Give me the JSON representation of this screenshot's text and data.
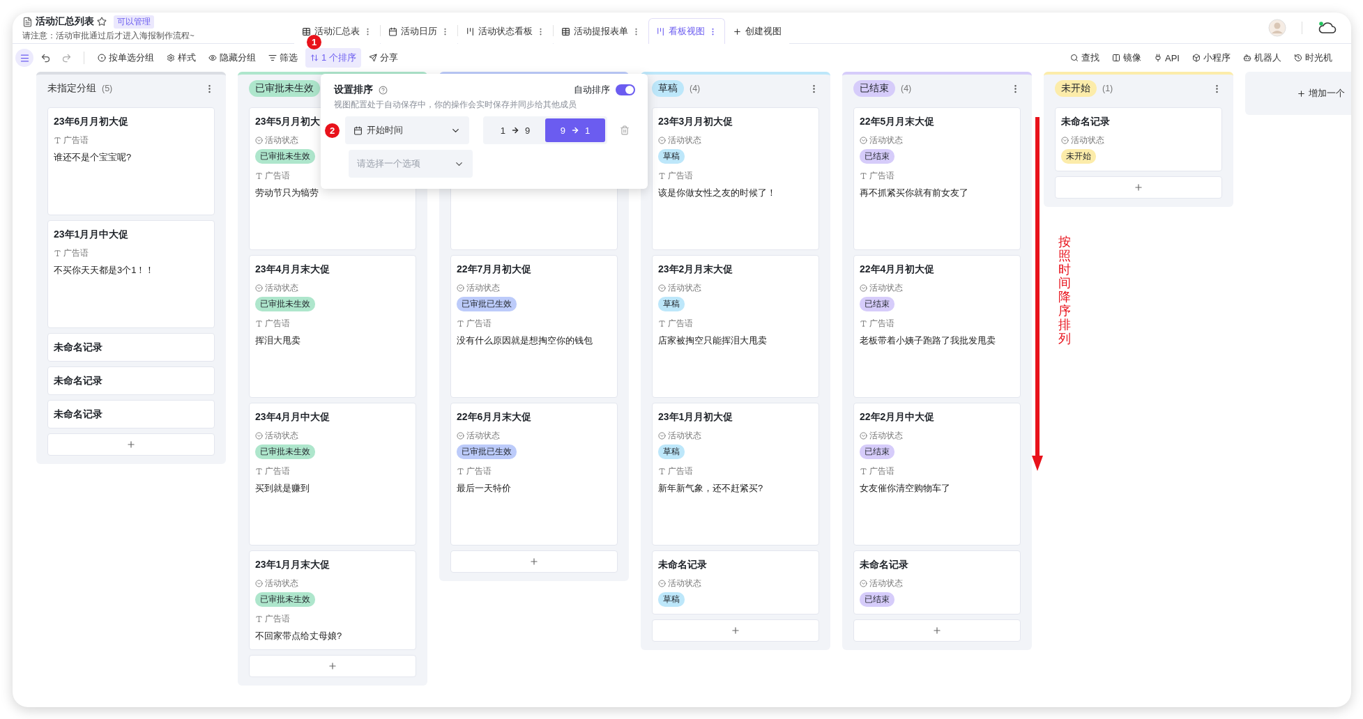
{
  "header": {
    "title": "活动汇总列表",
    "permission": "可以管理",
    "notice": "请注意：活动审批通过后才进入海报制作流程~"
  },
  "tabs": [
    {
      "label": "活动汇总表",
      "selected": false
    },
    {
      "label": "活动日历",
      "selected": false
    },
    {
      "label": "活动状态看板",
      "selected": false
    },
    {
      "label": "活动提报表单",
      "selected": false
    },
    {
      "label": "看板视图",
      "selected": true
    }
  ],
  "create_view": "创建视图",
  "toolbar": {
    "left": [
      {
        "label": "按单选分组",
        "selected": false
      },
      {
        "label": "样式",
        "selected": false
      },
      {
        "label": "隐藏分组",
        "selected": false
      },
      {
        "label": "筛选",
        "selected": false
      },
      {
        "label": "1 个排序",
        "selected": true
      },
      {
        "label": "分享",
        "selected": false
      }
    ],
    "right": [
      "查找",
      "镜像",
      "API",
      "小程序",
      "机器人",
      "时光机"
    ]
  },
  "annotations": {
    "step_1": "1",
    "step_2": "2",
    "note": "按照时间降序排列"
  },
  "sort_popup": {
    "title": "设置排序",
    "auto_sort_label": "自动排序",
    "auto_sort_on": true,
    "description": "视图配置处于自动保存中，你的操作会实时保存并同步给其他成员",
    "field": "开始时间",
    "orders": [
      {
        "from": "1",
        "to": "9",
        "selected": false
      },
      {
        "from": "9",
        "to": "1",
        "selected": true
      }
    ],
    "placeholder": "请选择一个选项"
  },
  "columns": [
    {
      "kind": "plain",
      "label": "未指定分组",
      "count": "(5)",
      "color": "#dadde3",
      "cards": [
        {
          "title": "23年6月月初大促",
          "fields": [
            {
              "kind": "text",
              "label": "广告语",
              "value": "谁还不是个宝宝呢?"
            }
          ]
        },
        {
          "title": "23年1月月中大促",
          "fields": [
            {
              "kind": "text",
              "label": "广告语",
              "value": "不买你天天都是3个1！！"
            }
          ]
        },
        {
          "title": "未命名记录"
        },
        {
          "title": "未命名记录"
        },
        {
          "title": "未命名记录"
        }
      ]
    },
    {
      "kind": "badge",
      "label": "已审批未生效",
      "color": "#aee6cc",
      "cards": [
        {
          "title": "23年5月月初大",
          "fields": [
            {
              "kind": "status",
              "label": "活动状态",
              "value": "已审批未生效",
              "color": "#aee6cc"
            },
            {
              "kind": "text",
              "label": "广告语",
              "value": "劳动节只为犒劳"
            }
          ]
        },
        {
          "title": "23年4月月末大促",
          "fields": [
            {
              "kind": "status",
              "label": "活动状态",
              "value": "已审批未生效",
              "color": "#aee6cc"
            },
            {
              "kind": "text",
              "label": "广告语",
              "value": "挥泪大甩卖"
            }
          ]
        },
        {
          "title": "23年4月月中大促",
          "fields": [
            {
              "kind": "status",
              "label": "活动状态",
              "value": "已审批未生效",
              "color": "#aee6cc"
            },
            {
              "kind": "text",
              "label": "广告语",
              "value": "买到就是赚到"
            }
          ]
        },
        {
          "title": "23年1月月末大促",
          "fields": [
            {
              "kind": "status",
              "label": "活动状态",
              "value": "已审批未生效",
              "color": "#aee6cc"
            },
            {
              "kind": "text",
              "label": "广告语",
              "value": "不回家带点给丈母娘?"
            }
          ]
        }
      ]
    },
    {
      "kind": "covered",
      "color": "#bccbfa",
      "cards": [
        {
          "kind": "covered"
        },
        {
          "title": "22年7月月初大促",
          "fields": [
            {
              "kind": "status",
              "label": "活动状态",
              "value": "已审批已生效",
              "color": "#bccbfa"
            },
            {
              "kind": "text",
              "label": "广告语",
              "value": "没有什么原因就是想掏空你的钱包"
            }
          ]
        },
        {
          "title": "22年6月月末大促",
          "fields": [
            {
              "kind": "status",
              "label": "活动状态",
              "value": "已审批已生效",
              "color": "#bccbfa"
            },
            {
              "kind": "text",
              "label": "广告语",
              "value": "最后一天特价"
            }
          ]
        }
      ]
    },
    {
      "kind": "badge",
      "label": "草稿",
      "count": "(4)",
      "color": "#bde7fa",
      "cards": [
        {
          "title": "23年3月月初大促",
          "fields": [
            {
              "kind": "status",
              "label": "活动状态",
              "value": "草稿",
              "color": "#bde7fa"
            },
            {
              "kind": "text",
              "label": "广告语",
              "value": "该是你做女性之友的时候了！"
            }
          ]
        },
        {
          "title": "23年2月月末大促",
          "fields": [
            {
              "kind": "status",
              "label": "活动状态",
              "value": "草稿",
              "color": "#bde7fa"
            },
            {
              "kind": "text",
              "label": "广告语",
              "value": "店家被掏空只能挥泪大甩卖"
            }
          ]
        },
        {
          "title": "23年1月月初大促",
          "fields": [
            {
              "kind": "status",
              "label": "活动状态",
              "value": "草稿",
              "color": "#bde7fa"
            },
            {
              "kind": "text",
              "label": "广告语",
              "value": "新年新气象，还不赶紧买?"
            }
          ]
        },
        {
          "title": "未命名记录",
          "fields": [
            {
              "kind": "status",
              "label": "活动状态",
              "value": "草稿",
              "color": "#bde7fa"
            }
          ]
        }
      ]
    },
    {
      "kind": "badge",
      "label": "已结束",
      "count": "(4)",
      "color": "#d6ccfa",
      "cards": [
        {
          "title": "22年5月月末大促",
          "fields": [
            {
              "kind": "status",
              "label": "活动状态",
              "value": "已结束",
              "color": "#d6ccfa"
            },
            {
              "kind": "text",
              "label": "广告语",
              "value": "再不抓紧买你就有前女友了"
            }
          ]
        },
        {
          "title": "22年4月月初大促",
          "fields": [
            {
              "kind": "status",
              "label": "活动状态",
              "value": "已结束",
              "color": "#d6ccfa"
            },
            {
              "kind": "text",
              "label": "广告语",
              "value": "老板带着小姨子跑路了我批发甩卖"
            }
          ]
        },
        {
          "title": "22年2月月中大促",
          "fields": [
            {
              "kind": "status",
              "label": "活动状态",
              "value": "已结束",
              "color": "#d6ccfa"
            },
            {
              "kind": "text",
              "label": "广告语",
              "value": "女友催你清空购物车了"
            }
          ]
        },
        {
          "title": "未命名记录",
          "fields": [
            {
              "kind": "status",
              "label": "活动状态",
              "value": "已结束",
              "color": "#d6ccfa"
            }
          ]
        }
      ]
    },
    {
      "kind": "badge",
      "label": "未开始",
      "count": "(1)",
      "color": "#fcecaa",
      "cards": [
        {
          "title": "未命名记录",
          "fields": [
            {
              "kind": "status",
              "label": "活动状态",
              "value": "未开始",
              "color": "#fcecaa"
            }
          ]
        }
      ]
    }
  ],
  "add_group": "增加一个"
}
